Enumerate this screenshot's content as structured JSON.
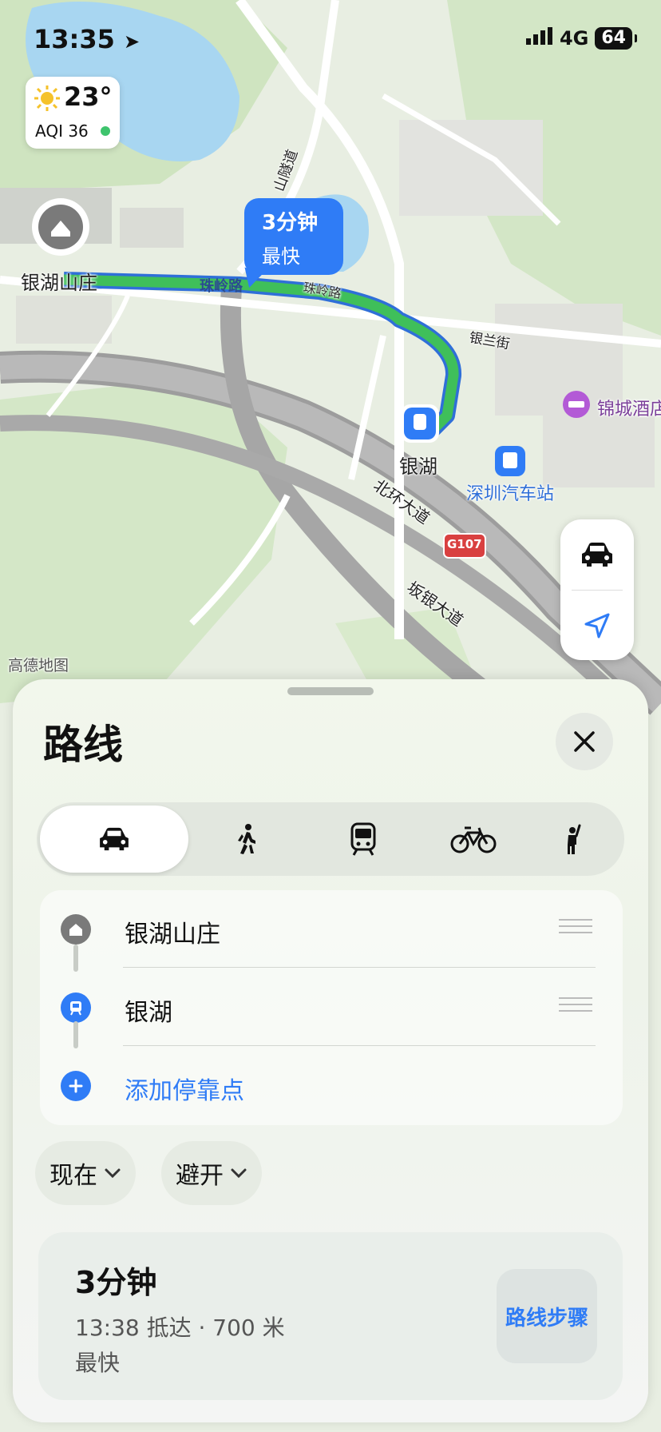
{
  "status": {
    "time": "13:35",
    "network": "4G",
    "battery": "64"
  },
  "weather": {
    "temp": "23°",
    "aqi": "AQI 36"
  },
  "map": {
    "labels": {
      "origin": "银湖山庄",
      "zhuling1": "珠岭路",
      "zhuling2": "珠岭路",
      "tunnel": "山隧道",
      "yinlan": "银兰街",
      "hotel": "锦城酒店",
      "station": "银湖",
      "bus": "深圳汽车站",
      "beihuan": "北环大道",
      "g107": "G107",
      "banyin": "坂银大道",
      "attribution": "高德地图"
    },
    "route_callout": {
      "time": "3分钟",
      "tag": "最快"
    },
    "controls": {
      "mode_icon": "car-icon",
      "locate_icon": "location-arrow-icon"
    },
    "colors": {
      "route": "#3fbf5a",
      "route_outline": "#2f6fd8",
      "accent": "#2f7cf6",
      "hotel": "#b35ad6"
    }
  },
  "sheet": {
    "title": "路线",
    "modes": [
      {
        "name": "drive",
        "icon": "car-icon",
        "selected": true
      },
      {
        "name": "walk",
        "icon": "walking-icon",
        "selected": false
      },
      {
        "name": "transit",
        "icon": "train-icon",
        "selected": false
      },
      {
        "name": "cycle",
        "icon": "bicycle-icon",
        "selected": false
      },
      {
        "name": "ride-hail",
        "icon": "hailing-person-icon",
        "selected": false
      }
    ],
    "stops": {
      "origin": "银湖山庄",
      "destination": "银湖",
      "add": "添加停靠点"
    },
    "options": {
      "time": "现在",
      "avoid": "避开"
    },
    "result": {
      "time": "3分钟",
      "detail": "13:38 抵达 · 700 米",
      "tag": "最快",
      "steps": "路线步骤"
    }
  }
}
